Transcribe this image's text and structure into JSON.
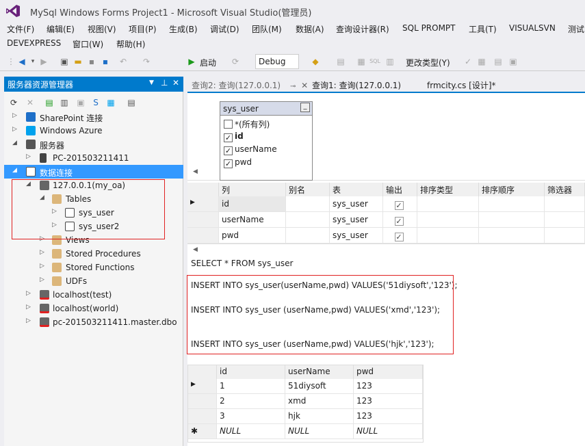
{
  "window": {
    "title": "MySql Windows Forms Project1 - Microsoft Visual Studio(管理员)"
  },
  "menu": {
    "row1": [
      "文件(F)",
      "编辑(E)",
      "视图(V)",
      "项目(P)",
      "生成(B)",
      "调试(D)",
      "团队(M)",
      "数据(A)",
      "查询设计器(R)",
      "SQL PROMPT",
      "工具(T)",
      "VISUALSVN",
      "测试"
    ],
    "row2": [
      "DEVEXPRESS",
      "窗口(W)",
      "帮助(H)"
    ]
  },
  "toolbar": {
    "start_label": "启动",
    "config_value": "Debug",
    "change_type_label": "更改类型(Y)"
  },
  "server_explorer": {
    "title": "服务器资源管理器",
    "tree": [
      {
        "label": "SharePoint 连接"
      },
      {
        "label": "Windows Azure"
      },
      {
        "label": "服务器"
      },
      {
        "label": "PC-201503211411"
      },
      {
        "label": "数据连接"
      },
      {
        "label": "127.0.0.1(my_oa)"
      },
      {
        "label": "Tables"
      },
      {
        "label": "sys_user"
      },
      {
        "label": "sys_user2"
      },
      {
        "label": "Views"
      },
      {
        "label": "Stored Procedures"
      },
      {
        "label": "Stored Functions"
      },
      {
        "label": "UDFs"
      },
      {
        "label": "localhost(test)"
      },
      {
        "label": "localhost(world)"
      },
      {
        "label": "pc-201503211411.master.dbo"
      }
    ]
  },
  "tabs": [
    {
      "label": "查询2: 查询(127.0.0.1)"
    },
    {
      "label": "查询1: 查询(127.0.0.1)"
    },
    {
      "label": "frmcity.cs [设计]*"
    }
  ],
  "diagram": {
    "table_name": "sys_user",
    "columns": [
      "*(所有列)",
      "id",
      "userName",
      "pwd"
    ],
    "checked": [
      false,
      true,
      false,
      true
    ]
  },
  "criteria": {
    "headers": [
      "列",
      "别名",
      "表",
      "输出",
      "排序类型",
      "排序顺序",
      "筛选器"
    ],
    "rows": [
      {
        "col": "id",
        "table": "sys_user"
      },
      {
        "col": "userName",
        "table": "sys_user"
      },
      {
        "col": "pwd",
        "table": "sys_user"
      }
    ]
  },
  "sql": {
    "lines": [
      "SELECT * FROM sys_user",
      "INSERT INTO sys_user(userName,pwd) VALUES('51diysoft','123');",
      "INSERT INTO sys_user (userName,pwd) VALUES('xmd','123');",
      "INSERT INTO sys_user (userName,pwd) VALUES('hjk','123');"
    ]
  },
  "results": {
    "headers": [
      "id",
      "userName",
      "pwd"
    ],
    "rows": [
      [
        "1",
        "51diysoft",
        "123"
      ],
      [
        "2",
        "xmd",
        "123"
      ],
      [
        "3",
        "hjk",
        "123"
      ],
      [
        "NULL",
        "NULL",
        "NULL"
      ]
    ]
  },
  "colors": {
    "accent": "#007acc",
    "selection": "#3399ff",
    "highlight_box": "#e02020"
  }
}
